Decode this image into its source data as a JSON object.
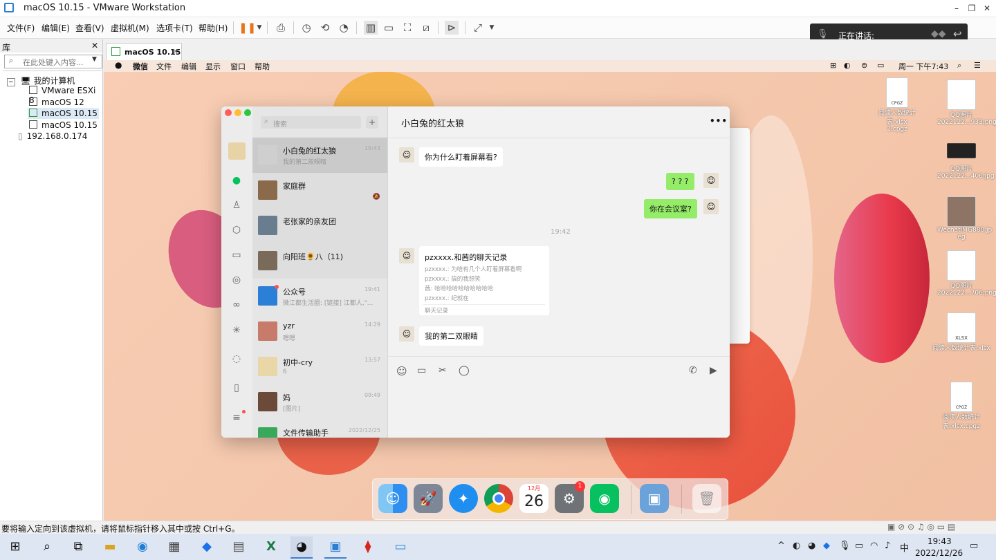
{
  "vmware": {
    "title": "macOS 10.15 - VMware Workstation",
    "menus": [
      "文件(F)",
      "编辑(E)",
      "查看(V)",
      "虚拟机(M)",
      "选项卡(T)",
      "帮助(H)"
    ],
    "win_controls": [
      "–",
      "❐",
      "✕"
    ],
    "speaking_label": "正在讲话:",
    "library": {
      "title": "库",
      "close": "✕",
      "search_placeholder": "在此处键入内容...",
      "root": "我的计算机",
      "items": [
        "VMware ESXi 8",
        "macOS 12",
        "macOS 10.15",
        "macOS 10.15"
      ],
      "remote": "192.168.0.174"
    },
    "tab_label": "macOS 10.15",
    "tab_close": "✕",
    "status_text": "要将输入定向到该虚拟机，请将鼠标指针移入其中或按 Ctrl+G。"
  },
  "mac_menubar": {
    "apple": "",
    "items": [
      "微信",
      "文件",
      "编辑",
      "显示",
      "窗口",
      "帮助"
    ],
    "clock": "周一 下午7:43"
  },
  "wechat": {
    "search_placeholder": "搜索",
    "add_button": "+",
    "conversations": [
      {
        "name": "小白兔的红太狼",
        "preview": "我的第二双眼睛",
        "time": "19:43",
        "color": "#cfcfcf"
      },
      {
        "name": "家庭群",
        "preview": "",
        "time": "",
        "color": "#8a6a4a"
      },
      {
        "name": "老张家的亲友团",
        "preview": "",
        "time": "",
        "color": "#6a7d8f"
      },
      {
        "name": "向阳班🌻八（11)",
        "preview": "",
        "time": "",
        "color": "#7a6a5a"
      },
      {
        "name": "公众号",
        "preview": "微江都生活圈: [链接] 江都人,\"...",
        "time": "19:41",
        "color": "#2c7fd6"
      },
      {
        "name": "yzr",
        "preview": "嗯嗯",
        "time": "14:29",
        "color": "#c77b6b"
      },
      {
        "name": "初中-cry",
        "preview": "6",
        "time": "13:57",
        "color": "#e9d7a8"
      },
      {
        "name": "妈",
        "preview": "[图片]",
        "time": "09:49",
        "color": "#6b4a3a"
      },
      {
        "name": "文件传输助手",
        "preview": "",
        "time": "2022/12/25",
        "color": "#3aa85a"
      }
    ],
    "chat_title": "小白兔的红太狼",
    "more": "•••",
    "messages": {
      "m1": "你为什么盯着屏幕看?",
      "m2": "? ? ?",
      "m3": "你在会议室?",
      "time_sep": "19:42",
      "record_title": "pzxxxx.和茜的聊天记录",
      "record_lines": [
        "pzxxxx.: 为啥有几个人盯着屏幕看啊",
        "pzxxxx.: 搞的我想笑",
        "茜: 哈哈哈哈哈哈哈哈哈哈",
        "pzxxxx.: 纪就在"
      ],
      "record_footer": "聊天记录",
      "m4": "我的第二双眼睛"
    }
  },
  "desktop_icons": [
    {
      "label": "阅读人数统计表.xlsx\n2.cpgz",
      "tag": "CPGZ"
    },
    {
      "label": "QQ图片\n2022122...933.png",
      "tag": ""
    },
    {
      "label": "QQ图片\n2022122...406.jpg",
      "tag": ""
    },
    {
      "label": "WechatIMG880.jp\neg",
      "tag": ""
    },
    {
      "label": "QQ图片\n2022122...706.png",
      "tag": ""
    },
    {
      "label": "阅读人数统计表.xlsx",
      "tag": "XLSX"
    },
    {
      "label": "阅读人数统计\n表.xlsx.cpgz",
      "tag": "CPGZ"
    }
  ],
  "dock": {
    "calendar_month": "12月",
    "calendar_day": "26",
    "settings_badge": "1"
  },
  "taskbar": {
    "ime": "中",
    "time": "19:43",
    "date": "2022/12/26"
  }
}
